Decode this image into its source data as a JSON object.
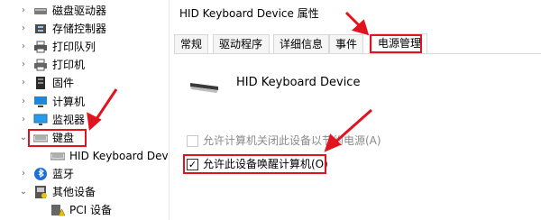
{
  "tree": {
    "items": [
      {
        "label": "磁盘驱动器",
        "icon": "disk-drive-icon",
        "expander": "›"
      },
      {
        "label": "存储控制器",
        "icon": "storage-controller-icon",
        "expander": "›"
      },
      {
        "label": "打印队列",
        "icon": "print-queue-icon",
        "expander": "›"
      },
      {
        "label": "打印机",
        "icon": "printer-icon",
        "expander": "›"
      },
      {
        "label": "固件",
        "icon": "firmware-icon",
        "expander": "›"
      },
      {
        "label": "计算机",
        "icon": "computer-icon",
        "expander": "›"
      },
      {
        "label": "监视器",
        "icon": "monitor-icon",
        "expander": "›"
      },
      {
        "label": "键盘",
        "icon": "keyboard-icon",
        "expander": "⌄"
      },
      {
        "label": "HID Keyboard Device",
        "icon": "keyboard-device-icon",
        "expander": ""
      },
      {
        "label": "蓝牙",
        "icon": "bluetooth-icon",
        "expander": "›"
      },
      {
        "label": "其他设备",
        "icon": "other-devices-icon",
        "expander": "⌄"
      },
      {
        "label": "PCI 设备",
        "icon": "pci-device-warning-icon",
        "expander": ""
      }
    ]
  },
  "dialog": {
    "title": "HID Keyboard Device 属性",
    "tabs": [
      "常规",
      "驱动程序",
      "详细信息",
      "事件",
      "电源管理"
    ],
    "active_tab": "电源管理",
    "device_name": "HID Keyboard Device",
    "option_allow_off": "允许计算机关闭此设备以节约电源(A)",
    "option_allow_off_checked": false,
    "option_allow_wake": "允许此设备唤醒计算机(O)",
    "option_allow_wake_checked": true
  },
  "colors": {
    "annotation_red": "#e0141e",
    "selection_bg": "#cce8ff"
  }
}
